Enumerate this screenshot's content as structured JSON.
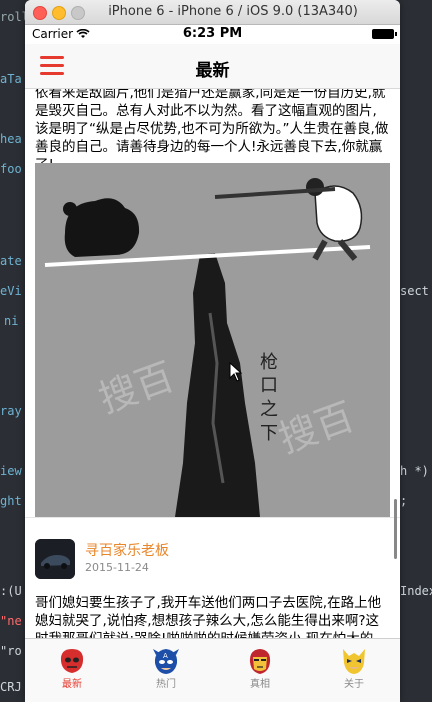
{
  "sim_window": {
    "title": "iPhone 6 - iPhone 6 / iOS 9.0 (13A340)"
  },
  "status_bar": {
    "carrier": "Carrier",
    "time": "6:23 PM"
  },
  "nav_bar": {
    "title": "最新",
    "menu_icon": "hamburger-menu-icon"
  },
  "feed": {
    "first_card": {
      "text": "依看来是敌圆片,他们是猎户还是赢家,同是是一份自历史,就是毁灭自己。总有人对此不以为然。看了这幅直观的图片,该是明了“纵是占尽优势,也不可为所欲为。”人生贵在善良,做善良的自己。请善待身边的每一个人!永远善良下去,你就赢了!",
      "image_alt": "cartoon: hunter aiming at bear on a balance board atop a cliff"
    },
    "second_card": {
      "author": "寻百家乐老板",
      "date": "2015-11-24",
      "text": "哥们媳妇要生孩子了,我开车送他们两口子去医院,在路上他媳妇就哭了,说怕疼,想想孩子辣么大,怎么能生得出来啊?这时我那哥们就说:哭啥!啪啪啪的时候嫌劳资小,现在怕大的了……"
    }
  },
  "tab_bar": {
    "tabs": [
      {
        "label": "最新",
        "icon": "red-hood-mask-icon",
        "active": true
      },
      {
        "label": "热门",
        "icon": "captain-america-mask-icon",
        "active": false
      },
      {
        "label": "真相",
        "icon": "iron-man-mask-icon",
        "active": false
      },
      {
        "label": "关于",
        "icon": "wolverine-mask-icon",
        "active": false
      }
    ]
  },
  "colors": {
    "accent": "#e63a2e",
    "author": "#e8862a"
  }
}
